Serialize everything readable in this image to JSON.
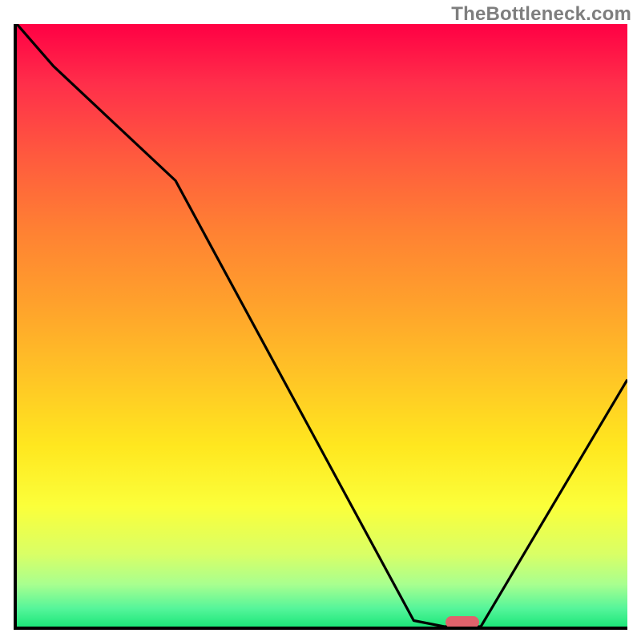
{
  "watermark": {
    "text": "TheBottleneck.com"
  },
  "chart_data": {
    "type": "line",
    "title": "",
    "xlabel": "",
    "ylabel": "",
    "xlim": [
      0,
      100
    ],
    "ylim": [
      0,
      100
    ],
    "grid": false,
    "background_gradient": {
      "type": "vertical",
      "stops": [
        {
          "pos": 0.0,
          "color": "#ff0044"
        },
        {
          "pos": 0.1,
          "color": "#ff2f4a"
        },
        {
          "pos": 0.22,
          "color": "#ff5a3e"
        },
        {
          "pos": 0.34,
          "color": "#ff8033"
        },
        {
          "pos": 0.46,
          "color": "#ffa02c"
        },
        {
          "pos": 0.58,
          "color": "#ffc326"
        },
        {
          "pos": 0.7,
          "color": "#ffe71f"
        },
        {
          "pos": 0.8,
          "color": "#fbff3a"
        },
        {
          "pos": 0.88,
          "color": "#d9ff66"
        },
        {
          "pos": 0.93,
          "color": "#a8ff8f"
        },
        {
          "pos": 0.97,
          "color": "#55f59a"
        },
        {
          "pos": 1.0,
          "color": "#1de77a"
        }
      ]
    },
    "series": [
      {
        "name": "bottleneck-curve",
        "x": [
          0,
          6,
          26,
          65,
          70,
          76,
          100
        ],
        "y": [
          100,
          93,
          74,
          1,
          0,
          0,
          41
        ]
      }
    ],
    "marker": {
      "name": "optimal-point",
      "x": 73,
      "y": 0,
      "color": "#e0626c",
      "shape": "rounded-rect"
    },
    "legend": false,
    "notes": "Curve values estimated from chart; y=0 is bottom (green), y=100 is top (red). Marker indicates the curve minimum on the x-axis."
  }
}
